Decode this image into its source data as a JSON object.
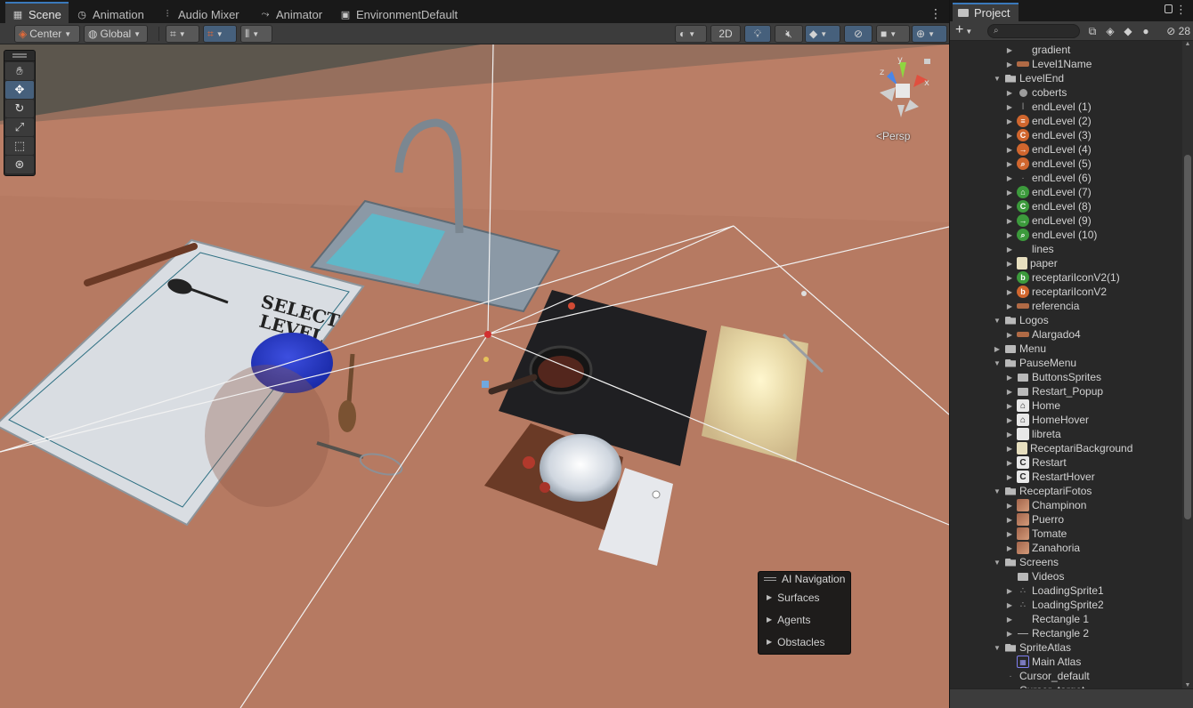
{
  "scene_tabs": [
    {
      "label": "Scene",
      "icon": "grid-icon"
    },
    {
      "label": "Animation",
      "icon": "clock-icon"
    },
    {
      "label": "Audio Mixer",
      "icon": "mixer-icon"
    },
    {
      "label": "Animator",
      "icon": "animator-icon"
    },
    {
      "label": "EnvironmentDefault",
      "icon": "lighting-icon"
    }
  ],
  "toolbar": {
    "pivot": "Center",
    "space": "Global",
    "mode_2d": "2D"
  },
  "gizmo": {
    "persp": "Persp",
    "y": "y",
    "x": "x",
    "z": "z"
  },
  "ai_navigation": {
    "title": "AI Navigation",
    "items": [
      "Surfaces",
      "Agents",
      "Obstacles"
    ]
  },
  "scene_content": {
    "paper_line1": "SELECT",
    "paper_line2": "LEVEL"
  },
  "project": {
    "tab": "Project",
    "hidden_count": "28",
    "search_placeholder": "",
    "rows": [
      {
        "label": "gradient",
        "depth": 2,
        "arrow": "right",
        "icon": "blank"
      },
      {
        "label": "Level1Name",
        "depth": 2,
        "arrow": "right",
        "icon": "bar"
      },
      {
        "label": "LevelEnd",
        "depth": 1,
        "arrow": "down",
        "icon": "folder-open"
      },
      {
        "label": "coberts",
        "depth": 2,
        "arrow": "right",
        "icon": "dot"
      },
      {
        "label": "endLevel (1)",
        "depth": 2,
        "arrow": "right",
        "icon": "tiny",
        "glyph": "ǀ"
      },
      {
        "label": "endLevel (2)",
        "depth": 2,
        "arrow": "right",
        "icon": "circle",
        "glyph": "≡"
      },
      {
        "label": "endLevel (3)",
        "depth": 2,
        "arrow": "right",
        "icon": "circle",
        "glyph": "C"
      },
      {
        "label": "endLevel (4)",
        "depth": 2,
        "arrow": "right",
        "icon": "circle",
        "glyph": "→"
      },
      {
        "label": "endLevel (5)",
        "depth": 2,
        "arrow": "right",
        "icon": "circle",
        "glyph": "⌕"
      },
      {
        "label": "endLevel (6)",
        "depth": 2,
        "arrow": "right",
        "icon": "tiny",
        "glyph": "·"
      },
      {
        "label": "endLevel (7)",
        "depth": 2,
        "arrow": "right",
        "icon": "green",
        "glyph": "⌂"
      },
      {
        "label": "endLevel (8)",
        "depth": 2,
        "arrow": "right",
        "icon": "green",
        "glyph": "C"
      },
      {
        "label": "endLevel (9)",
        "depth": 2,
        "arrow": "right",
        "icon": "green",
        "glyph": "→"
      },
      {
        "label": "endLevel (10)",
        "depth": 2,
        "arrow": "right",
        "icon": "green",
        "glyph": "⌕"
      },
      {
        "label": "lines",
        "depth": 2,
        "arrow": "right",
        "icon": "blank"
      },
      {
        "label": "paper",
        "depth": 2,
        "arrow": "right",
        "icon": "paper"
      },
      {
        "label": "receptariIconV2(1)",
        "depth": 2,
        "arrow": "right",
        "icon": "green",
        "glyph": "b"
      },
      {
        "label": "receptariIconV2",
        "depth": 2,
        "arrow": "right",
        "icon": "circle",
        "glyph": "b"
      },
      {
        "label": "referencia",
        "depth": 2,
        "arrow": "right",
        "icon": "bar"
      },
      {
        "label": "Logos",
        "depth": 1,
        "arrow": "down",
        "icon": "folder-open"
      },
      {
        "label": "Alargado4",
        "depth": 2,
        "arrow": "right",
        "icon": "bar"
      },
      {
        "label": "Menu",
        "depth": 1,
        "arrow": "right",
        "icon": "folder"
      },
      {
        "label": "PauseMenu",
        "depth": 1,
        "arrow": "down",
        "icon": "folder-open"
      },
      {
        "label": "ButtonsSprites",
        "depth": 2,
        "arrow": "right",
        "icon": "folder"
      },
      {
        "label": "Restart_Popup",
        "depth": 2,
        "arrow": "right",
        "icon": "folder"
      },
      {
        "label": "Home",
        "depth": 2,
        "arrow": "right",
        "icon": "white",
        "glyph": "⌂"
      },
      {
        "label": "HomeHover",
        "depth": 2,
        "arrow": "right",
        "icon": "white",
        "glyph": "⌂"
      },
      {
        "label": "libreta",
        "depth": 2,
        "arrow": "right",
        "icon": "white",
        "glyph": ""
      },
      {
        "label": "ReceptariBackground",
        "depth": 2,
        "arrow": "right",
        "icon": "paper"
      },
      {
        "label": "Restart",
        "depth": 2,
        "arrow": "right",
        "icon": "white",
        "glyph": "C"
      },
      {
        "label": "RestartHover",
        "depth": 2,
        "arrow": "right",
        "icon": "white",
        "glyph": "C"
      },
      {
        "label": "ReceptariFotos",
        "depth": 1,
        "arrow": "down",
        "icon": "folder-open"
      },
      {
        "label": "Champinon",
        "depth": 2,
        "arrow": "right",
        "icon": "photo"
      },
      {
        "label": "Puerro",
        "depth": 2,
        "arrow": "right",
        "icon": "photo"
      },
      {
        "label": "Tomate",
        "depth": 2,
        "arrow": "right",
        "icon": "photo"
      },
      {
        "label": "Zanahoria",
        "depth": 2,
        "arrow": "right",
        "icon": "photo"
      },
      {
        "label": "Screens",
        "depth": 1,
        "arrow": "down",
        "icon": "folder-open"
      },
      {
        "label": "Videos",
        "depth": 2,
        "arrow": "none",
        "icon": "folder"
      },
      {
        "label": "LoadingSprite1",
        "depth": 2,
        "arrow": "right",
        "icon": "tiny",
        "glyph": "∴"
      },
      {
        "label": "LoadingSprite2",
        "depth": 2,
        "arrow": "right",
        "icon": "tiny",
        "glyph": "∴"
      },
      {
        "label": "Rectangle 1",
        "depth": 2,
        "arrow": "right",
        "icon": "blank"
      },
      {
        "label": "Rectangle 2",
        "depth": 2,
        "arrow": "right",
        "icon": "line"
      },
      {
        "label": "SpriteAtlas",
        "depth": 1,
        "arrow": "down",
        "icon": "folder-open"
      },
      {
        "label": "Main Atlas",
        "depth": 2,
        "arrow": "none",
        "icon": "atlas",
        "glyph": "▦"
      },
      {
        "label": "Cursor_default",
        "depth": 1,
        "arrow": "none",
        "icon": "tiny",
        "glyph": "·"
      },
      {
        "label": "Cursor_target",
        "depth": 1,
        "arrow": "none",
        "icon": "tiny",
        "glyph": "·"
      }
    ]
  }
}
